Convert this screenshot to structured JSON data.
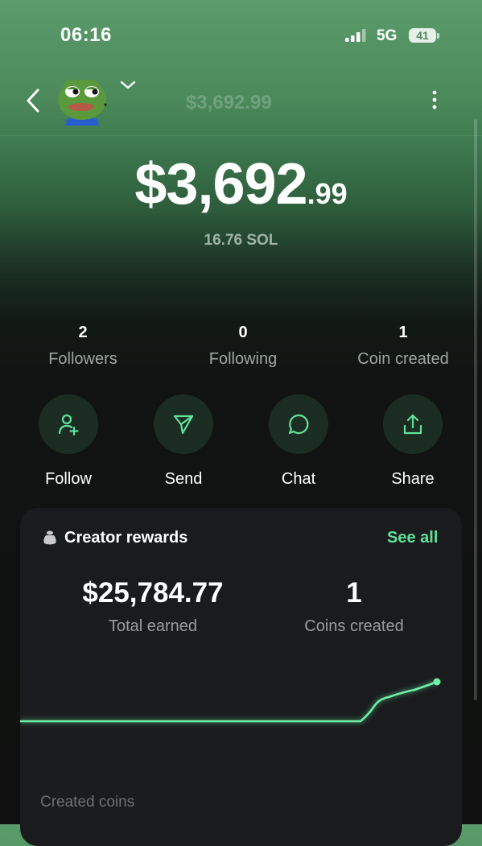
{
  "status_bar": {
    "time": "06:16",
    "network": "5G",
    "battery": "41"
  },
  "header": {
    "amount": "$3,692.99",
    "avatar": "pepe-avatar"
  },
  "balance": {
    "main": "$3,692",
    "cents": ".99",
    "sol": "16.76 SOL"
  },
  "stats": [
    {
      "value": "2",
      "label": "Followers"
    },
    {
      "value": "0",
      "label": "Following"
    },
    {
      "value": "1",
      "label": "Coin created"
    }
  ],
  "actions": [
    {
      "label": "Follow",
      "icon": "person-add-icon"
    },
    {
      "label": "Send",
      "icon": "send-icon"
    },
    {
      "label": "Chat",
      "icon": "chat-icon"
    },
    {
      "label": "Share",
      "icon": "share-icon"
    }
  ],
  "rewards": {
    "title": "Creator rewards",
    "see_all": "See all",
    "total_earned_value": "$25,784.77",
    "total_earned_label": "Total earned",
    "coins_created_value": "1",
    "coins_created_label": "Coins created",
    "accent_color": "#5fe39a"
  },
  "section": {
    "created_coins": "Created coins"
  }
}
